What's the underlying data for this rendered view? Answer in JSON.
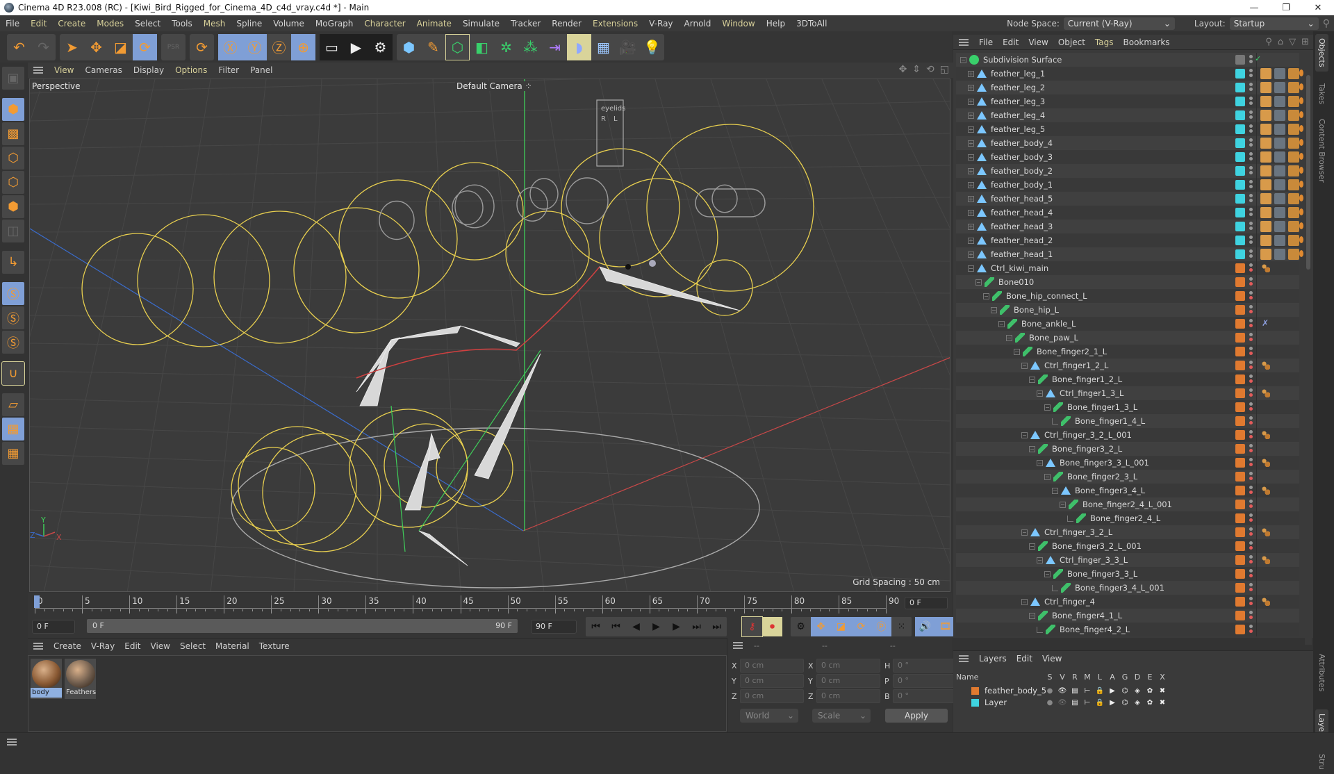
{
  "window": {
    "title": "Cinema 4D R23.008 (RC) - [Kiwi_Bird_Rigged_for_Cinema_4D_c4d_vray.c4d *] - Main",
    "controls": [
      "—",
      "❐",
      "✕"
    ]
  },
  "menubar": {
    "items": [
      {
        "label": "File",
        "hl": false
      },
      {
        "label": "Edit",
        "hl": true
      },
      {
        "label": "Create",
        "hl": true
      },
      {
        "label": "Modes",
        "hl": true
      },
      {
        "label": "Select",
        "hl": false
      },
      {
        "label": "Tools",
        "hl": false
      },
      {
        "label": "Mesh",
        "hl": true
      },
      {
        "label": "Spline",
        "hl": false
      },
      {
        "label": "Volume",
        "hl": false
      },
      {
        "label": "MoGraph",
        "hl": false
      },
      {
        "label": "Character",
        "hl": true
      },
      {
        "label": "Animate",
        "hl": true
      },
      {
        "label": "Simulate",
        "hl": false
      },
      {
        "label": "Tracker",
        "hl": false
      },
      {
        "label": "Render",
        "hl": false
      },
      {
        "label": "Extensions",
        "hl": true
      },
      {
        "label": "V-Ray",
        "hl": false
      },
      {
        "label": "Arnold",
        "hl": false
      },
      {
        "label": "Window",
        "hl": true
      },
      {
        "label": "Help",
        "hl": false
      },
      {
        "label": "3DToAll",
        "hl": false
      }
    ],
    "node_space_label": "Node Space:",
    "node_space_value": "Current (V-Ray)",
    "layout_label": "Layout:",
    "layout_value": "Startup"
  },
  "toolbar": {
    "groups": [
      [
        {
          "icon": "undo-icon",
          "glyph": "↶",
          "state": ""
        },
        {
          "icon": "redo-icon",
          "glyph": "↷",
          "state": "dim"
        }
      ],
      [
        {
          "icon": "select-cursor-icon",
          "glyph": "➤",
          "state": ""
        },
        {
          "icon": "move-icon",
          "glyph": "✥",
          "state": ""
        },
        {
          "icon": "scale-icon",
          "glyph": "◪",
          "state": ""
        },
        {
          "icon": "rotate-icon",
          "glyph": "⟳",
          "state": "on"
        }
      ],
      [
        {
          "icon": "psr-icon",
          "glyph": "PSR",
          "state": "dim"
        }
      ],
      [
        {
          "icon": "recent-tools-icon",
          "glyph": "⟳",
          "state": ""
        }
      ],
      [
        {
          "icon": "x-axis-icon",
          "glyph": "Ⓧ",
          "state": "on"
        },
        {
          "icon": "y-axis-icon",
          "glyph": "Ⓨ",
          "state": "on"
        },
        {
          "icon": "z-axis-icon",
          "glyph": "Ⓩ",
          "state": ""
        },
        {
          "icon": "coordinate-system-icon",
          "glyph": "⊕",
          "state": "on"
        }
      ],
      [
        {
          "icon": "render-view-icon",
          "glyph": "▭",
          "state": ""
        },
        {
          "icon": "render-picture-viewer-icon",
          "glyph": "▶",
          "state": ""
        },
        {
          "icon": "render-settings-icon",
          "glyph": "⚙",
          "state": ""
        }
      ],
      [
        {
          "icon": "cube-icon",
          "glyph": "⬢",
          "state": ""
        },
        {
          "icon": "pen-icon",
          "glyph": "✎",
          "state": ""
        },
        {
          "icon": "subdivision-surface-icon",
          "glyph": "⬡",
          "state": "outl"
        },
        {
          "icon": "extrude-icon",
          "glyph": "◧",
          "state": ""
        },
        {
          "icon": "mograph-cloner-icon",
          "glyph": "✲",
          "state": ""
        },
        {
          "icon": "array-icon",
          "glyph": "⁂",
          "state": ""
        },
        {
          "icon": "deformer-icon",
          "glyph": "⇥",
          "state": ""
        },
        {
          "icon": "field-icon",
          "glyph": "◗",
          "state": "yel"
        },
        {
          "icon": "floor-icon",
          "glyph": "▦",
          "state": ""
        },
        {
          "icon": "camera-icon",
          "glyph": "🎥",
          "state": ""
        },
        {
          "icon": "light-icon",
          "glyph": "💡",
          "state": ""
        }
      ]
    ]
  },
  "left_toolbar": [
    {
      "icon": "make-editable-icon",
      "glyph": "▣",
      "state": "dim"
    },
    {
      "sep": true
    },
    {
      "icon": "model-mode-icon",
      "glyph": "⬢",
      "state": "on"
    },
    {
      "icon": "texture-mode-icon",
      "glyph": "▩",
      "state": ""
    },
    {
      "icon": "points-mode-icon",
      "glyph": "⬡",
      "state": ""
    },
    {
      "icon": "edges-mode-icon",
      "glyph": "⬡",
      "state": ""
    },
    {
      "icon": "polygons-mode-icon",
      "glyph": "⬢",
      "state": ""
    },
    {
      "icon": "uv-mode-icon",
      "glyph": "◫",
      "state": "dim"
    },
    {
      "sep": true
    },
    {
      "icon": "axis-mode-icon",
      "glyph": "↳",
      "state": ""
    },
    {
      "sep": true
    },
    {
      "icon": "snap-icon",
      "glyph": "Ⓢ",
      "state": "on"
    },
    {
      "icon": "snap-settings-icon",
      "glyph": "Ⓢ",
      "state": ""
    },
    {
      "icon": "snap-workplane-icon",
      "glyph": "Ⓢ",
      "state": ""
    },
    {
      "sep": true
    },
    {
      "icon": "magnet-icon",
      "glyph": "∪",
      "state": "outl"
    },
    {
      "sep": true
    },
    {
      "icon": "workplane-icon",
      "glyph": "▱",
      "state": ""
    },
    {
      "icon": "locked-workplane-icon",
      "glyph": "▦",
      "state": "on"
    },
    {
      "icon": "workplane-rotate-icon",
      "glyph": "▦",
      "state": ""
    }
  ],
  "viewport": {
    "menu": [
      {
        "label": "View",
        "hl": true
      },
      {
        "label": "Cameras",
        "hl": false
      },
      {
        "label": "Display",
        "hl": false
      },
      {
        "label": "Options",
        "hl": true
      },
      {
        "label": "Filter",
        "hl": false
      },
      {
        "label": "Panel",
        "hl": false
      }
    ],
    "nav_icons": [
      {
        "name": "pan-icon",
        "glyph": "✥"
      },
      {
        "name": "dolly-icon",
        "glyph": "⇕"
      },
      {
        "name": "orbit-icon",
        "glyph": "⟲"
      },
      {
        "name": "maximize-icon",
        "glyph": "◱"
      }
    ],
    "projection": "Perspective",
    "camera": "Default Camera",
    "grid_spacing": "Grid Spacing : 50 cm",
    "axis_labels": {
      "x": "X",
      "y": "Y",
      "z": "Z"
    },
    "eyelids_label": "eyelids",
    "eyelids_r": "R",
    "eyelids_l": "L"
  },
  "timeline": {
    "ticks": [
      0,
      5,
      10,
      15,
      20,
      25,
      30,
      35,
      40,
      45,
      50,
      55,
      60,
      65,
      70,
      75,
      80,
      85,
      90
    ],
    "min": 0,
    "max": 90,
    "current_frame": "0 F",
    "start_field": "0 F",
    "range_start": "0 F",
    "range_end": "90 F",
    "end_field": "90 F"
  },
  "transport": {
    "playback": [
      {
        "icon": "go-to-start-icon",
        "glyph": "⏮"
      },
      {
        "icon": "previous-key-icon",
        "glyph": "⏮"
      },
      {
        "icon": "previous-frame-icon",
        "glyph": "◀"
      },
      {
        "icon": "play-icon",
        "glyph": "▶"
      },
      {
        "icon": "next-frame-icon",
        "glyph": "▶"
      },
      {
        "icon": "next-key-icon",
        "glyph": "⏭"
      },
      {
        "icon": "go-to-end-icon",
        "glyph": "⏭"
      }
    ],
    "record": [
      {
        "icon": "record-keys-icon",
        "glyph": "⚷",
        "state": "outl"
      },
      {
        "icon": "autokey-icon",
        "glyph": "⏺",
        "state": "yel"
      }
    ],
    "key_tools": [
      {
        "icon": "keyframe-selection-icon",
        "glyph": "⚙",
        "state": ""
      },
      {
        "icon": "key-position-icon",
        "glyph": "✥",
        "state": "on"
      },
      {
        "icon": "key-scale-icon",
        "glyph": "◪",
        "state": "on"
      },
      {
        "icon": "key-rotation-icon",
        "glyph": "⟳",
        "state": "on"
      },
      {
        "icon": "key-parameter-icon",
        "glyph": "Ⓟ",
        "state": "on"
      },
      {
        "icon": "key-pla-icon",
        "glyph": "⁙",
        "state": ""
      }
    ],
    "extra": [
      {
        "icon": "sound-icon",
        "glyph": "🔊",
        "state": "on"
      },
      {
        "icon": "film-icon",
        "glyph": "🎞",
        "state": "on"
      }
    ]
  },
  "material_manager": {
    "menu": [
      "Create",
      "V-Ray",
      "Edit",
      "View",
      "Select",
      "Material",
      "Texture"
    ],
    "materials": [
      {
        "name": "body",
        "selected": true,
        "color": "#8a5a34"
      },
      {
        "name": "Feathers",
        "selected": false,
        "color": "#6d5b4c"
      }
    ]
  },
  "coordinates": {
    "header": [
      "--",
      "--",
      "--"
    ],
    "rows": [
      {
        "a1": "X",
        "v1": "0 cm",
        "a2": "X",
        "v2": "0 cm",
        "a3": "H",
        "v3": "0 °"
      },
      {
        "a1": "Y",
        "v1": "0 cm",
        "a2": "Y",
        "v2": "0 cm",
        "a3": "P",
        "v3": "0 °"
      },
      {
        "a1": "Z",
        "v1": "0 cm",
        "a2": "Z",
        "v2": "0 cm",
        "a3": "B",
        "v3": "0 °"
      }
    ],
    "space": "World",
    "mode": "Scale",
    "apply": "Apply"
  },
  "object_manager": {
    "menu": [
      {
        "label": "File",
        "hl": false
      },
      {
        "label": "Edit",
        "hl": false
      },
      {
        "label": "View",
        "hl": false
      },
      {
        "label": "Object",
        "hl": false
      },
      {
        "label": "Tags",
        "hl": true
      },
      {
        "label": "Bookmarks",
        "hl": false
      }
    ],
    "header_icons": [
      {
        "name": "search-icon",
        "glyph": "⚲"
      },
      {
        "name": "home-icon",
        "glyph": "⌂"
      },
      {
        "name": "filter-icon",
        "glyph": "▽"
      },
      {
        "name": "new-view-icon",
        "glyph": "⊞"
      }
    ],
    "objects": [
      {
        "name": "Subdivision Surface",
        "depth": 0,
        "type": "subdiv",
        "expand": "minus",
        "layer": "",
        "tags": "check"
      },
      {
        "name": "feather_leg_1",
        "depth": 1,
        "type": "null",
        "expand": "plus",
        "layer": "#3fd3e0",
        "tags": "mats"
      },
      {
        "name": "feather_leg_2",
        "depth": 1,
        "type": "null",
        "expand": "plus",
        "layer": "#3fd3e0",
        "tags": "mats"
      },
      {
        "name": "feather_leg_3",
        "depth": 1,
        "type": "null",
        "expand": "plus",
        "layer": "#3fd3e0",
        "tags": "mats"
      },
      {
        "name": "feather_leg_4",
        "depth": 1,
        "type": "null",
        "expand": "plus",
        "layer": "#3fd3e0",
        "tags": "mats"
      },
      {
        "name": "feather_leg_5",
        "depth": 1,
        "type": "null",
        "expand": "plus",
        "layer": "#3fd3e0",
        "tags": "mats"
      },
      {
        "name": "feather_body_4",
        "depth": 1,
        "type": "null",
        "expand": "plus",
        "layer": "#3fd3e0",
        "tags": "mats"
      },
      {
        "name": "feather_body_3",
        "depth": 1,
        "type": "null",
        "expand": "plus",
        "layer": "#3fd3e0",
        "tags": "mats"
      },
      {
        "name": "feather_body_2",
        "depth": 1,
        "type": "null",
        "expand": "plus",
        "layer": "#3fd3e0",
        "tags": "mats"
      },
      {
        "name": "feather_body_1",
        "depth": 1,
        "type": "null",
        "expand": "plus",
        "layer": "#3fd3e0",
        "tags": "mats"
      },
      {
        "name": "feather_head_5",
        "depth": 1,
        "type": "null",
        "expand": "plus",
        "layer": "#3fd3e0",
        "tags": "mats"
      },
      {
        "name": "feather_head_4",
        "depth": 1,
        "type": "null",
        "expand": "plus",
        "layer": "#3fd3e0",
        "tags": "mats"
      },
      {
        "name": "feather_head_3",
        "depth": 1,
        "type": "null",
        "expand": "plus",
        "layer": "#3fd3e0",
        "tags": "mats"
      },
      {
        "name": "feather_head_2",
        "depth": 1,
        "type": "null",
        "expand": "plus",
        "layer": "#3fd3e0",
        "tags": "mats"
      },
      {
        "name": "feather_head_1",
        "depth": 1,
        "type": "null",
        "expand": "plus",
        "layer": "#3fd3e0",
        "tags": "mats"
      },
      {
        "name": "Ctrl_kiwi_main",
        "depth": 1,
        "type": "null",
        "expand": "minus",
        "layer": "#e07a30",
        "tags": "constraint"
      },
      {
        "name": "Bone010",
        "depth": 2,
        "type": "bone",
        "expand": "minus",
        "layer": "#e07a30",
        "tags": ""
      },
      {
        "name": "Bone_hip_connect_L",
        "depth": 3,
        "type": "bone",
        "expand": "minus",
        "layer": "#e07a30",
        "tags": ""
      },
      {
        "name": "Bone_hip_L",
        "depth": 4,
        "type": "bone",
        "expand": "minus",
        "layer": "#e07a30",
        "tags": ""
      },
      {
        "name": "Bone_ankle_L",
        "depth": 5,
        "type": "bone",
        "expand": "minus",
        "layer": "#e07a30",
        "tags": "ik"
      },
      {
        "name": "Bone_paw_L",
        "depth": 6,
        "type": "bone",
        "expand": "minus",
        "layer": "#e07a30",
        "tags": ""
      },
      {
        "name": "Bone_finger2_1_L",
        "depth": 7,
        "type": "bone",
        "expand": "minus",
        "layer": "#e07a30",
        "tags": ""
      },
      {
        "name": "Ctrl_finger1_2_L",
        "depth": 8,
        "type": "null",
        "expand": "minus",
        "layer": "#e07a30",
        "tags": "constraint"
      },
      {
        "name": "Bone_finger1_2_L",
        "depth": 9,
        "type": "bone",
        "expand": "minus",
        "layer": "#e07a30",
        "tags": ""
      },
      {
        "name": "Ctrl_finger1_3_L",
        "depth": 10,
        "type": "null",
        "expand": "minus",
        "layer": "#e07a30",
        "tags": "constraint"
      },
      {
        "name": "Bone_finger1_3_L",
        "depth": 11,
        "type": "bone",
        "expand": "minus",
        "layer": "#e07a30",
        "tags": ""
      },
      {
        "name": "Bone_finger1_4_L",
        "depth": 12,
        "type": "bone",
        "expand": "leaf",
        "layer": "#e07a30",
        "tags": ""
      },
      {
        "name": "Ctrl_finger_3_2_L_001",
        "depth": 8,
        "type": "null",
        "expand": "minus",
        "layer": "#e07a30",
        "tags": "constraint"
      },
      {
        "name": "Bone_finger3_2_L",
        "depth": 9,
        "type": "bone",
        "expand": "minus",
        "layer": "#e07a30",
        "tags": ""
      },
      {
        "name": "Bone_finger3_3_L_001",
        "depth": 10,
        "type": "null",
        "expand": "minus",
        "layer": "#e07a30",
        "tags": "constraint"
      },
      {
        "name": "Bone_finger2_3_L",
        "depth": 11,
        "type": "bone",
        "expand": "minus",
        "layer": "#e07a30",
        "tags": ""
      },
      {
        "name": "Bone_finger3_4_L",
        "depth": 12,
        "type": "null",
        "expand": "minus",
        "layer": "#e07a30",
        "tags": "constraint"
      },
      {
        "name": "Bone_finger2_4_L_001",
        "depth": 13,
        "type": "bone",
        "expand": "minus",
        "layer": "#e07a30",
        "tags": ""
      },
      {
        "name": "Bone_finger2_4_L",
        "depth": 14,
        "type": "bone",
        "expand": "leaf",
        "layer": "#e07a30",
        "tags": ""
      },
      {
        "name": "Ctrl_finger_3_2_L",
        "depth": 8,
        "type": "null",
        "expand": "minus",
        "layer": "#e07a30",
        "tags": "constraint"
      },
      {
        "name": "Bone_finger3_2_L_001",
        "depth": 9,
        "type": "bone",
        "expand": "minus",
        "layer": "#e07a30",
        "tags": ""
      },
      {
        "name": "Ctrl_finger_3_3_L",
        "depth": 10,
        "type": "null",
        "expand": "minus",
        "layer": "#e07a30",
        "tags": "constraint"
      },
      {
        "name": "Bone_finger3_3_L",
        "depth": 11,
        "type": "bone",
        "expand": "minus",
        "layer": "#e07a30",
        "tags": ""
      },
      {
        "name": "Bone_finger3_4_L_001",
        "depth": 12,
        "type": "bone",
        "expand": "leaf",
        "layer": "#e07a30",
        "tags": ""
      },
      {
        "name": "Ctrl_finger_4",
        "depth": 8,
        "type": "null",
        "expand": "minus",
        "layer": "#e07a30",
        "tags": "constraint"
      },
      {
        "name": "Bone_finger4_1_L",
        "depth": 9,
        "type": "bone",
        "expand": "minus",
        "layer": "#e07a30",
        "tags": ""
      },
      {
        "name": "Bone_finger4_2_L",
        "depth": 10,
        "type": "bone",
        "expand": "leaf",
        "layer": "#e07a30",
        "tags": ""
      }
    ]
  },
  "side_tabs_top": [
    {
      "label": "Objects",
      "active": true
    },
    {
      "label": "Takes",
      "active": false
    },
    {
      "label": "Content Browser",
      "active": false
    }
  ],
  "side_tabs_bottom": [
    {
      "label": "Attributes",
      "active": false
    },
    {
      "label": "Layers",
      "active": true
    },
    {
      "label": "Stru",
      "active": false
    }
  ],
  "layers": {
    "menu": [
      "Layers",
      "Edit",
      "View"
    ],
    "columns": [
      "Name",
      "S",
      "V",
      "R",
      "M",
      "L",
      "A",
      "G",
      "D",
      "E",
      "X"
    ],
    "rows": [
      {
        "name": "feather_body_5",
        "color": "#e07a30",
        "visible": true
      },
      {
        "name": "Layer",
        "color": "#3fd3e0",
        "visible": false
      }
    ],
    "row_icons": [
      "●",
      "👁",
      "▤",
      "⊢",
      "🔒",
      "▶",
      "⌬",
      "◈",
      "✿",
      "✖"
    ]
  },
  "colors": {
    "accent_blue": "#7f9fd6",
    "accent_yellow": "#d9d49a",
    "orange": "#f29b33",
    "menu_highlight": "#d8d19a"
  }
}
